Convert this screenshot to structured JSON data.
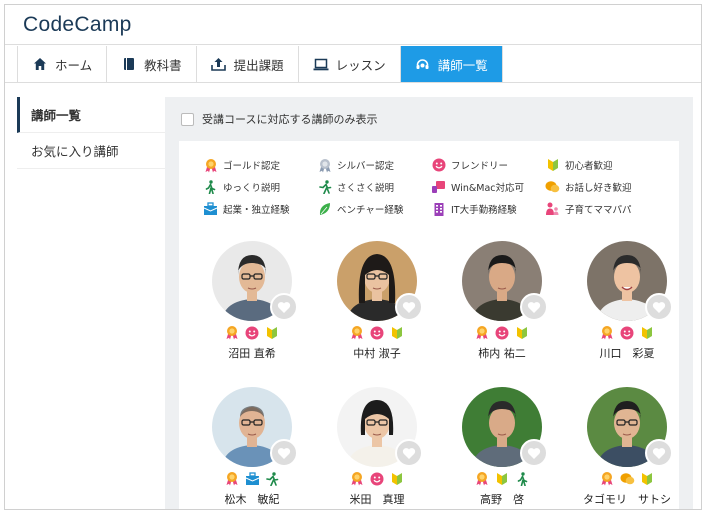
{
  "brand": {
    "logo": "CodeCamp"
  },
  "tabs": [
    {
      "label": "ホーム",
      "icon": "home-icon"
    },
    {
      "label": "教科書",
      "icon": "book-icon"
    },
    {
      "label": "提出課題",
      "icon": "upload-icon"
    },
    {
      "label": "レッスン",
      "icon": "laptop-icon"
    },
    {
      "label": "講師一覧",
      "icon": "headset-icon",
      "active": true
    }
  ],
  "sidebar": {
    "items": [
      {
        "label": "講師一覧",
        "active": true
      },
      {
        "label": "お気に入り講師"
      }
    ]
  },
  "filter": {
    "label": "受講コースに対応する講師のみ表示"
  },
  "legend": [
    {
      "label": "ゴールド認定",
      "icon": "gold-medal-icon"
    },
    {
      "label": "シルバー認定",
      "icon": "silver-medal-icon"
    },
    {
      "label": "フレンドリー",
      "icon": "smile-icon"
    },
    {
      "label": "初心者歓迎",
      "icon": "beginner-mark-icon"
    },
    {
      "label": "ゆっくり説明",
      "icon": "walking-icon"
    },
    {
      "label": "さくさく説明",
      "icon": "running-icon"
    },
    {
      "label": "Win&Mac対応可",
      "icon": "devices-icon"
    },
    {
      "label": "お話し好き歓迎",
      "icon": "chat-bubble-icon"
    },
    {
      "label": "起業・独立経験",
      "icon": "briefcase-icon"
    },
    {
      "label": "ベンチャー経験",
      "icon": "leaf-icon"
    },
    {
      "label": "IT大手勤務経験",
      "icon": "building-icon"
    },
    {
      "label": "子育てママパパ",
      "icon": "parent-icon"
    }
  ],
  "instructors": [
    {
      "name": "沼田 直希",
      "badges": [
        "gold-medal-icon",
        "smile-icon",
        "beginner-mark-icon"
      ]
    },
    {
      "name": "中村 淑子",
      "badges": [
        "gold-medal-icon",
        "smile-icon",
        "beginner-mark-icon"
      ]
    },
    {
      "name": "柿内 祐二",
      "badges": [
        "gold-medal-icon",
        "smile-icon",
        "beginner-mark-icon"
      ]
    },
    {
      "name": "川口　彩夏",
      "badges": [
        "gold-medal-icon",
        "smile-icon",
        "beginner-mark-icon"
      ]
    },
    {
      "name": "松木　敏紀",
      "badges": [
        "gold-medal-icon",
        "briefcase-icon",
        "running-icon"
      ]
    },
    {
      "name": "米田　真理",
      "badges": [
        "gold-medal-icon",
        "smile-icon",
        "beginner-mark-icon"
      ]
    },
    {
      "name": "高野　啓",
      "badges": [
        "gold-medal-icon",
        "beginner-mark-icon",
        "walking-icon"
      ]
    },
    {
      "name": "タゴモリ　サトシ",
      "badges": [
        "gold-medal-icon",
        "chat-bubble-icon",
        "beginner-mark-icon"
      ]
    }
  ],
  "colors": {
    "accent": "#1e9be6",
    "brand": "#1b3a57",
    "gold": "#f5a623",
    "pink": "#e8457a",
    "green": "#8cc63f",
    "darkgreen": "#1e8a4a",
    "blue": "#1e8fd1",
    "purple": "#9b3fb8",
    "orange": "#f0a000"
  }
}
